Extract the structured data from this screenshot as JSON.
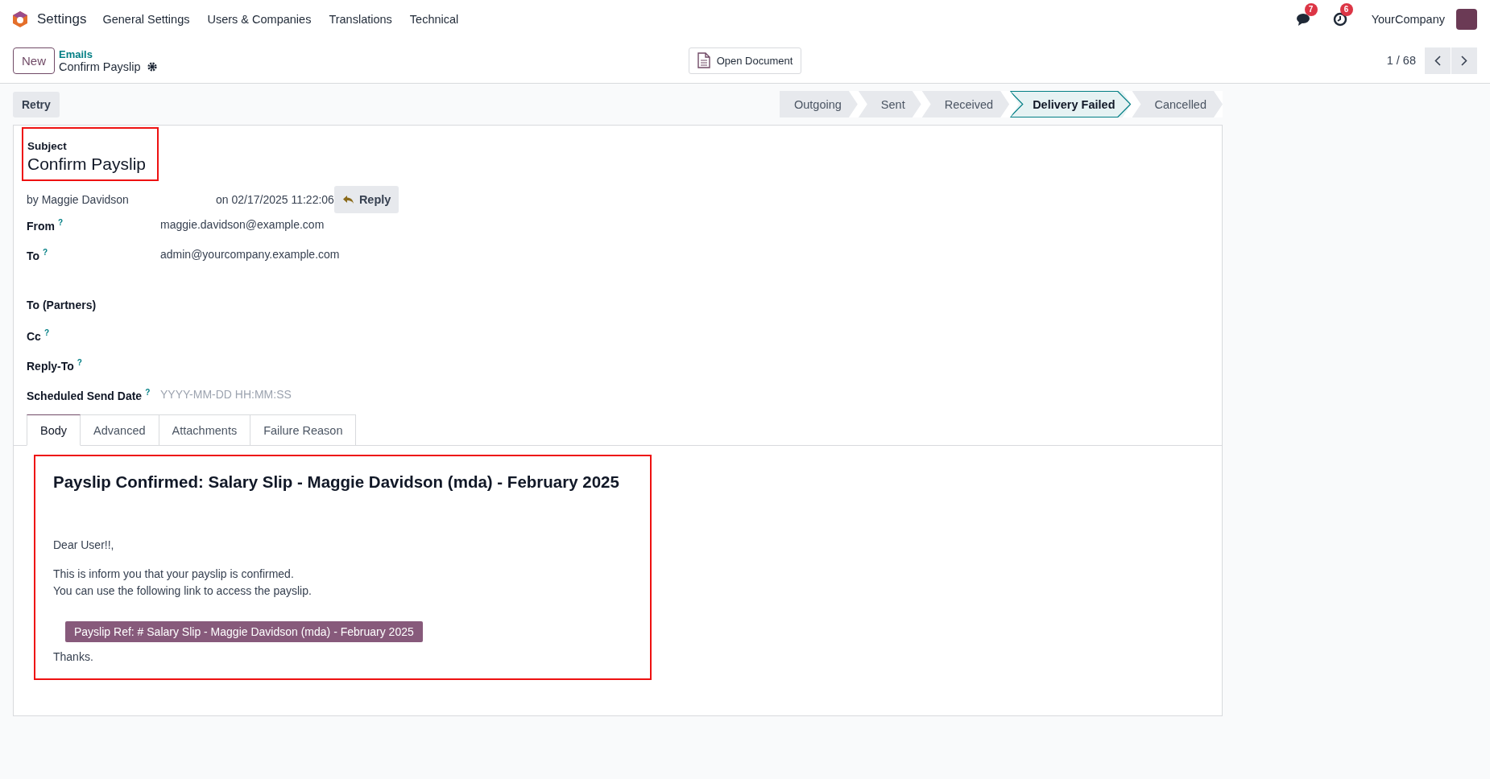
{
  "app": {
    "name": "Settings",
    "menu": [
      "General Settings",
      "Users & Companies",
      "Translations",
      "Technical"
    ]
  },
  "systray": {
    "messages_count": "7",
    "activities_count": "6",
    "company": "YourCompany"
  },
  "control_panel": {
    "new_button": "New",
    "breadcrumb": "Emails",
    "record": "Confirm Payslip",
    "open_document": "Open Document",
    "pager": "1 / 68"
  },
  "actions": {
    "retry": "Retry"
  },
  "stages": [
    {
      "label": "Outgoing",
      "selected": false
    },
    {
      "label": "Sent",
      "selected": false
    },
    {
      "label": "Received",
      "selected": false
    },
    {
      "label": "Delivery Failed",
      "selected": true
    },
    {
      "label": "Cancelled",
      "selected": false
    }
  ],
  "subject": {
    "label": "Subject",
    "value": "Confirm Payslip",
    "highlighted": true
  },
  "meta": {
    "author": "by Maggie Davidson",
    "date": "on 02/17/2025 11:22:06",
    "reply": "Reply"
  },
  "fields": [
    {
      "kind": "text",
      "label": "From",
      "help": "?",
      "value": "maggie.davidson@example.com"
    },
    {
      "kind": "text",
      "label": "To",
      "help": "?",
      "value": "admin@yourcompany.example.com"
    },
    {
      "kind": "tags",
      "label": "To (Partners)"
    },
    {
      "kind": "text",
      "label": "Cc",
      "help": "?"
    },
    {
      "kind": "text",
      "label": "Reply-To",
      "help": "?"
    },
    {
      "kind": "text",
      "label": "Scheduled Send Date",
      "help": "?",
      "placeholder": "YYYY-MM-DD HH:MM:SS"
    }
  ],
  "tabs": [
    {
      "label": "Body",
      "selected": true
    },
    {
      "label": "Advanced",
      "selected": false
    },
    {
      "label": "Attachments",
      "selected": false
    },
    {
      "label": "Failure Reason",
      "selected": false
    }
  ],
  "body": {
    "highlighted": true,
    "heading": "Payslip Confirmed: Salary Slip - Maggie Davidson (mda) - February 2025",
    "greeting": "Dear User!!,",
    "lines": [
      "This is inform you that your payslip is confirmed.",
      "You can use the following link to access the payslip."
    ],
    "link": "Payslip Ref: # Salary Slip - Maggie Davidson (mda) - February 2025",
    "closing": "Thanks."
  }
}
